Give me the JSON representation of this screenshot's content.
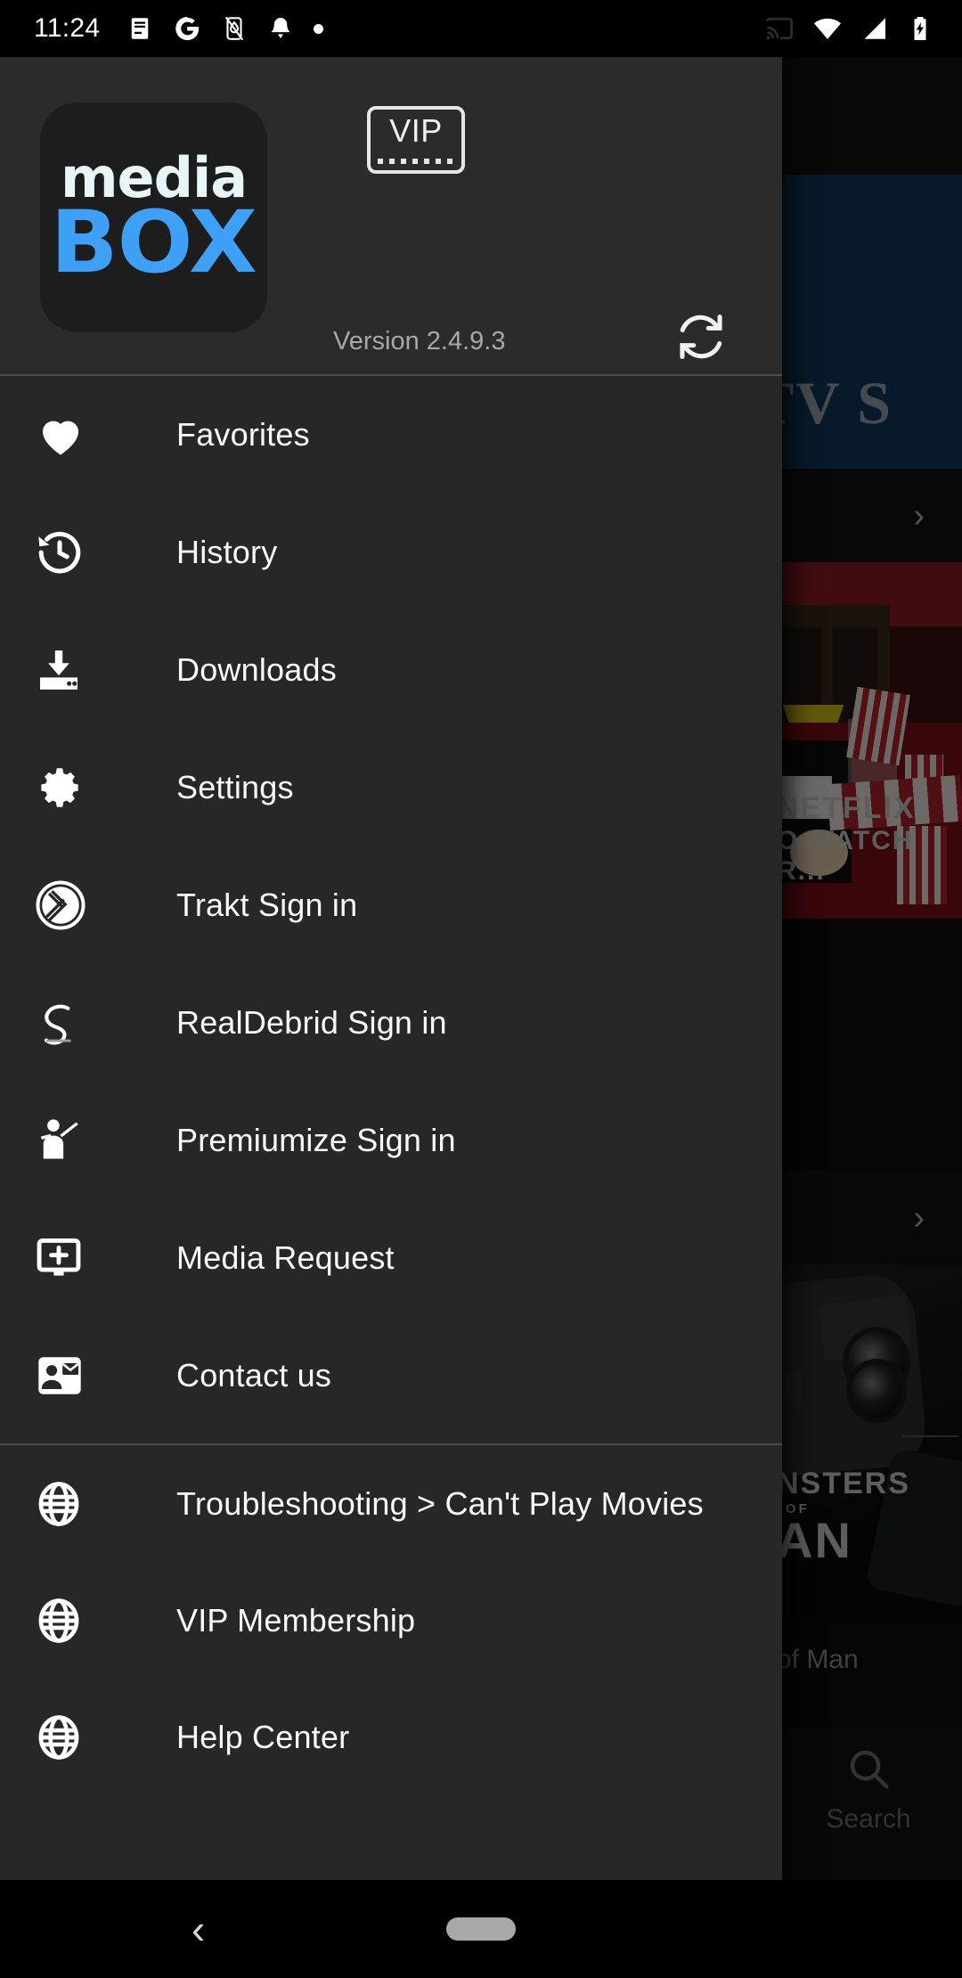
{
  "status_bar": {
    "time": "11:24",
    "left_icons": [
      "notes-icon",
      "google-icon",
      "alarm-off-icon",
      "alarm-bell-icon",
      "dot-icon"
    ],
    "right_icons": [
      "cast-icon",
      "wifi-icon",
      "cellular-signal-icon",
      "battery-charging-icon"
    ]
  },
  "drawer": {
    "logo": {
      "line1": "media",
      "line2": "BOX",
      "line1_color": "#e9f6f8",
      "line2_color": "#3fa0f7",
      "tile_color": "#1d1d1d"
    },
    "vip_badge": {
      "label": "VIP",
      "icon": "film-strip-icon"
    },
    "version": "Version 2.4.9.3",
    "refresh": {
      "icon": "refresh-sync-icon",
      "label": "Refresh"
    },
    "menu_primary": [
      {
        "label": "Favorites",
        "icon": "heart-icon"
      },
      {
        "label": "History",
        "icon": "history-clock-icon"
      },
      {
        "label": "Downloads",
        "icon": "download-tray-icon"
      },
      {
        "label": "Settings",
        "icon": "gear-icon"
      },
      {
        "label": "Trakt Sign in",
        "icon": "trakt-logo-icon"
      },
      {
        "label": "RealDebrid Sign in",
        "icon": "realdebrid-logo-icon"
      },
      {
        "label": "Premiumize Sign in",
        "icon": "premiumize-logo-icon"
      },
      {
        "label": "Media Request",
        "icon": "monitor-plus-icon"
      },
      {
        "label": "Contact us",
        "icon": "contact-mail-icon"
      }
    ],
    "menu_links": [
      {
        "label": "Troubleshooting > Can't Play Movies",
        "icon": "globe-icon"
      },
      {
        "label": "VIP Membership",
        "icon": "globe-icon"
      },
      {
        "label": "Help Center",
        "icon": "globe-icon"
      }
    ]
  },
  "background_app": {
    "hero_text": "TV S",
    "hero_color": "#123a5e",
    "row_chevron": "›",
    "cards": [
      {
        "overlay_line1": "NETFLIX",
        "overlay_line2": "O WATCH R...",
        "label": ""
      },
      {
        "overlay_line1": "NSTERS",
        "overlay_line2": "OF",
        "overlay_line3": "AN",
        "label": "of Man"
      }
    ],
    "bottom_nav": {
      "label": "Search",
      "icon": "search-icon"
    }
  },
  "navigation_bar": {
    "back": "back-chevron-icon",
    "home": "home-pill-icon"
  }
}
